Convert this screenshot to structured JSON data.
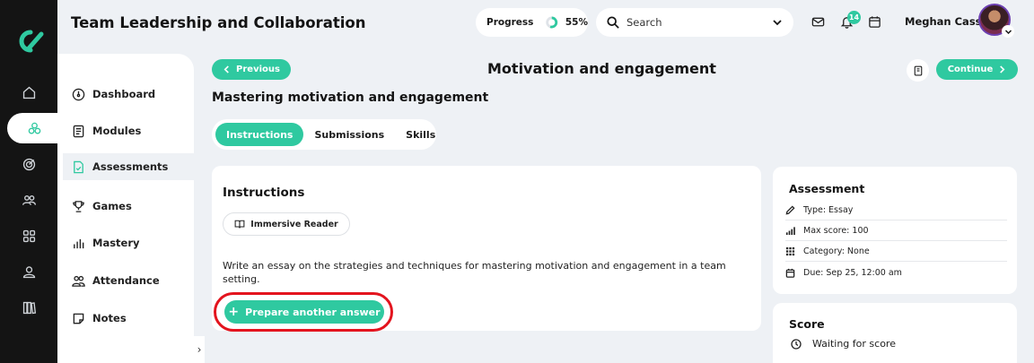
{
  "header": {
    "title": "Team Leadership and Collaboration",
    "progress_label": "Progress",
    "progress_value": "55%",
    "progress_fraction": 0.55,
    "search_placeholder": "Search",
    "notification_count": "14",
    "user_name": "Meghan Cass"
  },
  "rail": {
    "icons": [
      "home-icon",
      "modules-hub-icon",
      "target-icon",
      "team-icon",
      "grid-icon",
      "profile-icon",
      "library-icon"
    ],
    "active_index": 1
  },
  "sidebar": {
    "items": [
      {
        "label": "Dashboard",
        "icon": "dashboard-icon"
      },
      {
        "label": "Modules",
        "icon": "modules-icon"
      },
      {
        "label": "Assessments",
        "icon": "assessment-icon"
      },
      {
        "label": "Games",
        "icon": "trophy-icon"
      },
      {
        "label": "Mastery",
        "icon": "mastery-icon"
      },
      {
        "label": "Attendance",
        "icon": "attendance-icon"
      },
      {
        "label": "Notes",
        "icon": "notes-icon"
      }
    ],
    "active_index": 2
  },
  "content": {
    "previous_label": "Previous",
    "continue_label": "Continue",
    "page_title": "Motivation and engagement",
    "subtitle": "Mastering motivation and engagement",
    "tabs": [
      "Instructions",
      "Submissions",
      "Skills"
    ],
    "active_tab": 0,
    "instructions": {
      "heading": "Instructions",
      "reader_label": "Immersive Reader",
      "text": "Write an essay on the strategies and techniques for mastering motivation and engagement in a team setting.",
      "prepare_label": "Prepare another answer"
    },
    "assessment": {
      "heading": "Assessment",
      "rows": [
        {
          "icon": "pencil-icon",
          "text": "Type: Essay"
        },
        {
          "icon": "signal-icon",
          "text": "Max score: 100"
        },
        {
          "icon": "category-icon",
          "text": "Category: None"
        },
        {
          "icon": "calendar-icon",
          "text": "Due: Sep 25, 12:00 am"
        }
      ]
    },
    "score": {
      "heading": "Score",
      "status": "Waiting for score"
    }
  },
  "colors": {
    "accent": "#2fc9a0",
    "rail": "#141414",
    "background": "#eef1f5",
    "highlight": "#e3141e"
  }
}
